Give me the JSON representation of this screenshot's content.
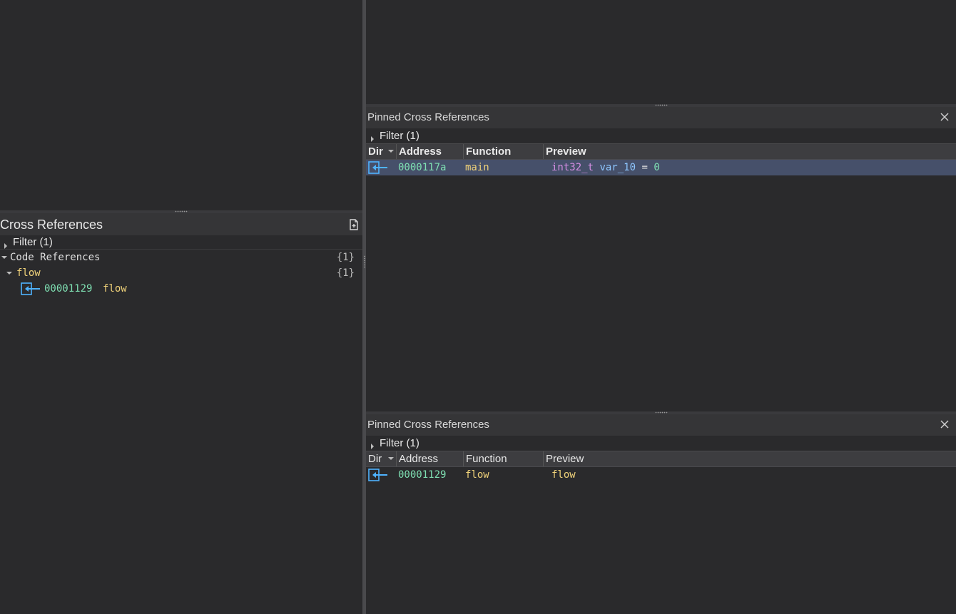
{
  "left": {
    "title": "Cross References",
    "filter_label": "Filter (1)",
    "code_refs_label": "Code References",
    "code_refs_count": "{1}",
    "func_label": "flow",
    "func_count": "{1}",
    "ref_address": "00001129",
    "ref_name": "flow"
  },
  "pinned_top": {
    "title": "Pinned Cross References",
    "filter_label": "Filter (1)",
    "columns": [
      "Dir",
      "Address",
      "Function",
      "Preview"
    ],
    "row": {
      "address": "0000117a",
      "function": "main",
      "preview_type": "int32_t",
      "preview_var": "var_10",
      "preview_op": "=",
      "preview_val": "0"
    }
  },
  "pinned_bottom": {
    "title": "Pinned Cross References",
    "filter_label": "Filter (1)",
    "columns": [
      "Dir",
      "Address",
      "Function",
      "Preview"
    ],
    "row": {
      "address": "00001129",
      "function": "flow",
      "preview": "flow"
    }
  },
  "icons": {
    "dir": "incoming-arrow-icon",
    "doc": "new-document-icon",
    "close": "close-icon"
  },
  "colors": {
    "address": "#7fe0b3",
    "function": "#f0d27a",
    "type": "#d58ee3",
    "variable": "#8fc7ff",
    "selection": "#46506a"
  }
}
